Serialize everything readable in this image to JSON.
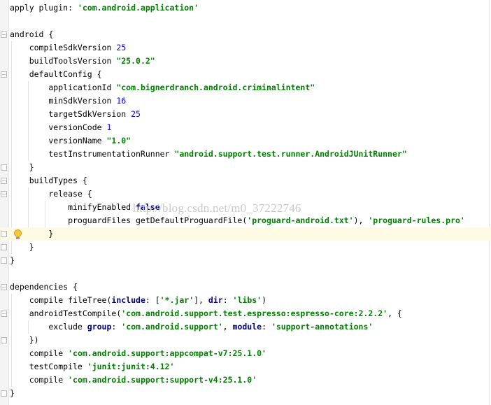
{
  "editor": {
    "language": "groovy",
    "watermark": "http://blog.csdn.net/m0_37222746",
    "highlighted_line": 17,
    "colors": {
      "keyword": "#000080",
      "string": "#008000",
      "number": "#0000ff",
      "highlight_background": "#fffae3",
      "gutter": "#f4f4f4"
    },
    "icons": [
      "fold-marker-icon",
      "lightbulb-icon"
    ],
    "lines": [
      "apply plugin: 'com.android.application'",
      "",
      "android {",
      "    compileSdkVersion 25",
      "    buildToolsVersion \"25.0.2\"",
      "    defaultConfig {",
      "        applicationId \"com.bignerdranch.android.criminalintent\"",
      "        minSdkVersion 16",
      "        targetSdkVersion 25",
      "        versionCode 1",
      "        versionName \"1.0\"",
      "        testInstrumentationRunner \"android.support.test.runner.AndroidJUnitRunner\"",
      "    }",
      "    buildTypes {",
      "        release {",
      "            minifyEnabled false",
      "            proguardFiles getDefaultProguardFile('proguard-android.txt'), 'proguard-rules.pro'",
      "        }",
      "    }",
      "}",
      "",
      "dependencies {",
      "    compile fileTree(include: ['*.jar'], dir: 'libs')",
      "    androidTestCompile('com.android.support.test.espresso:espresso-core:2.2.2', {",
      "        exclude group: 'com.android.support', module: 'support-annotations'",
      "    })",
      "    compile 'com.android.support:appcompat-v7:25.1.0'",
      "    testCompile 'junit:junit:4.12'",
      "    compile 'com.android.support:support-v4:25.1.0'",
      "}"
    ]
  }
}
